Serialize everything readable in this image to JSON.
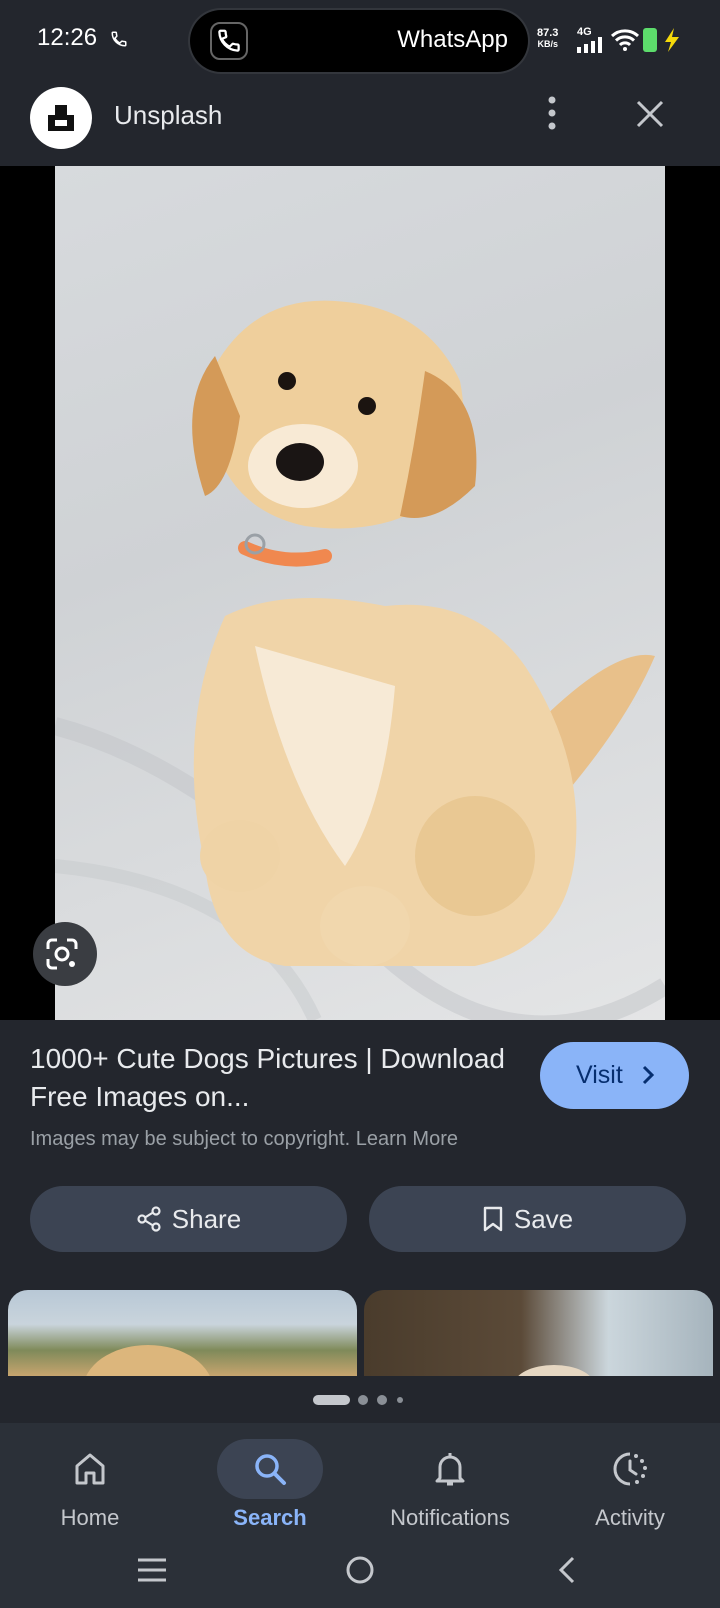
{
  "status_bar": {
    "time": "12:26",
    "call_app": "WhatsApp",
    "speed_value": "87.3",
    "speed_unit": "KB/s",
    "network": "4G"
  },
  "header": {
    "site_name": "Unsplash"
  },
  "result": {
    "title": "1000+ Cute Dogs Pictures | Download Free Images on...",
    "visit_label": "Visit",
    "copyright_note": "Images may be subject to copyright. Learn More",
    "share_label": "Share",
    "save_label": "Save"
  },
  "bottom_nav": {
    "items": [
      {
        "label": "Home",
        "icon": "home-icon",
        "active": false
      },
      {
        "label": "Search",
        "icon": "search-icon",
        "active": true
      },
      {
        "label": "Notifications",
        "icon": "bell-icon",
        "active": false
      },
      {
        "label": "Activity",
        "icon": "activity-icon",
        "active": false
      }
    ]
  },
  "colors": {
    "background": "#23262d",
    "accent": "#8ab4f8",
    "button_bg": "#3c4453"
  }
}
